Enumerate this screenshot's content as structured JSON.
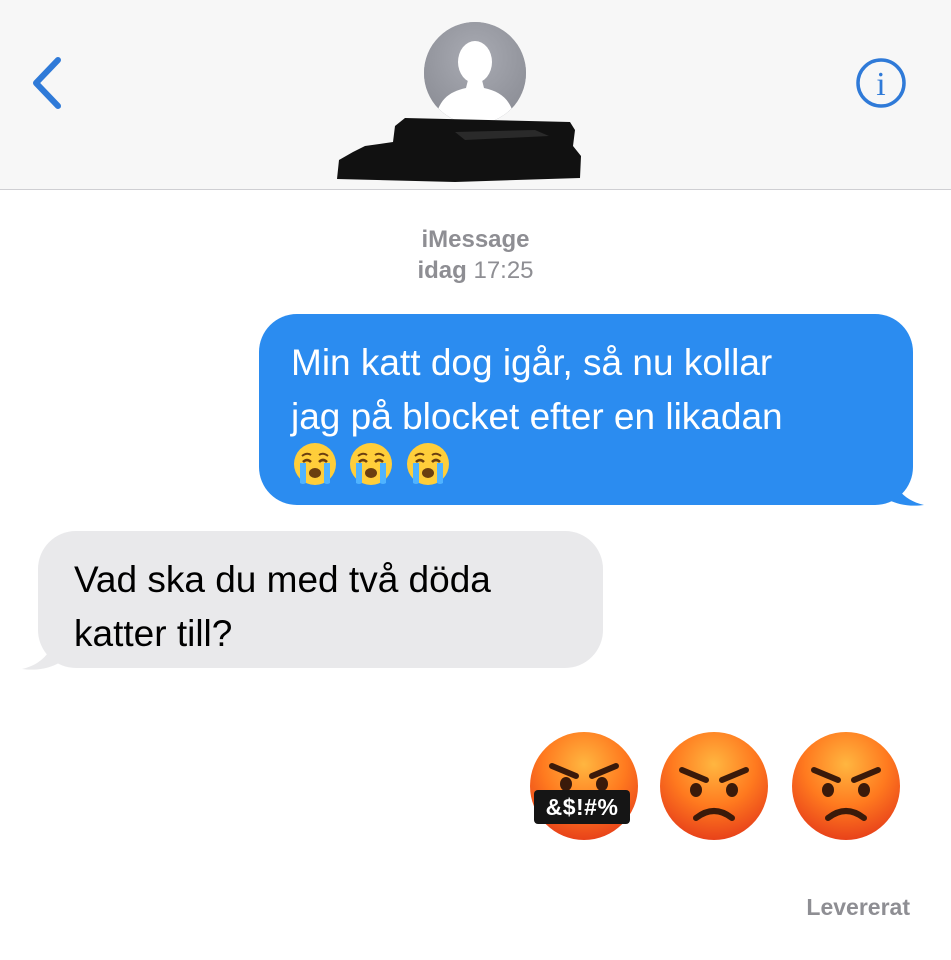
{
  "header": {
    "back_icon": "chevron-left-icon",
    "avatar_icon": "person-silhouette-icon",
    "info_icon": "info-icon",
    "info_glyph": "i",
    "accent_color": "#2f7ad8"
  },
  "conversation": {
    "service": "iMessage",
    "timestamp_day": "idag",
    "timestamp_time": "17:25",
    "messages": [
      {
        "direction": "outgoing",
        "lines": [
          "Min katt dog igår, så nu kollar",
          "jag på blocket efter en likadan"
        ],
        "emoji": [
          "crying-face-icon",
          "crying-face-icon",
          "crying-face-icon"
        ],
        "bubble_color": "#2b8cf0"
      },
      {
        "direction": "incoming",
        "lines": [
          "Vad ska du med två döda",
          "katter till?"
        ],
        "bubble_color": "#e9e9eb"
      },
      {
        "direction": "outgoing",
        "emoji": [
          "face-with-symbols-on-mouth-icon",
          "angry-face-icon",
          "angry-face-icon"
        ],
        "emoji_text": "&$!#%"
      }
    ],
    "status": "Levererat"
  }
}
